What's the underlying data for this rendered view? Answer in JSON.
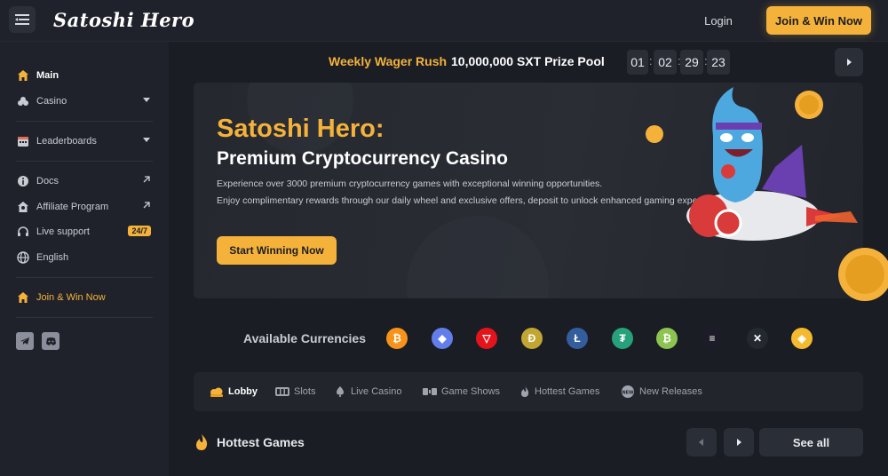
{
  "header": {
    "logo": "Satoshi Hero",
    "login_label": "Login",
    "join_label": "Join & Win Now"
  },
  "sidebar": {
    "items": [
      {
        "label": "Main",
        "icon": "home-icon"
      },
      {
        "label": "Casino",
        "icon": "cards-icon"
      },
      {
        "label": "Leaderboards",
        "icon": "calendar-icon"
      },
      {
        "label": "Docs",
        "icon": "info-icon"
      },
      {
        "label": "Affiliate Program",
        "icon": "affiliate-icon"
      },
      {
        "label": "Live support",
        "icon": "headset-icon",
        "badge": "24/7"
      },
      {
        "label": "English",
        "icon": "globe-icon"
      },
      {
        "label": "Join & Win Now",
        "icon": "home-icon"
      }
    ],
    "social": [
      "telegram-icon",
      "discord-icon"
    ]
  },
  "wager": {
    "title": "Weekly Wager Rush",
    "prize": "10,000,000 SXT Prize Pool",
    "timer": [
      "01",
      "02",
      "29",
      "23"
    ]
  },
  "hero": {
    "title": "Satoshi Hero:",
    "subtitle": "Premium Cryptocurrency Casino",
    "line1": "Experience over 3000 premium cryptocurrency games with exceptional winning opportunities.",
    "line2": "Enjoy complimentary rewards through our daily wheel and exclusive offers, deposit to unlock enhanced gaming experiences!",
    "cta": "Start Winning Now"
  },
  "currencies": {
    "label": "Available Currencies",
    "items": [
      {
        "name": "bitcoin-icon",
        "glyph": "₿",
        "color": "#f7931a"
      },
      {
        "name": "ethereum-icon",
        "glyph": "◆",
        "color": "#627eea"
      },
      {
        "name": "tron-icon",
        "glyph": "▽",
        "color": "#e5141b"
      },
      {
        "name": "dogecoin-icon",
        "glyph": "Ð",
        "color": "#c2a633"
      },
      {
        "name": "litecoin-icon",
        "glyph": "Ł",
        "color": "#345d9d"
      },
      {
        "name": "tether-icon",
        "glyph": "₮",
        "color": "#26a17b"
      },
      {
        "name": "bitcoin-cash-icon",
        "glyph": "₿",
        "color": "#8dc351"
      },
      {
        "name": "solana-icon",
        "glyph": "≡",
        "color": "#1c1c28"
      },
      {
        "name": "xrp-icon",
        "glyph": "✕",
        "color": "#23292f"
      },
      {
        "name": "bnb-icon",
        "glyph": "◈",
        "color": "#f3ba2f"
      }
    ]
  },
  "tabs": [
    {
      "label": "Lobby",
      "icon": "lobby-icon"
    },
    {
      "label": "Slots",
      "icon": "slots-icon"
    },
    {
      "label": "Live Casino",
      "icon": "spade-icon"
    },
    {
      "label": "Game Shows",
      "icon": "game-shows-icon"
    },
    {
      "label": "Hottest Games",
      "icon": "flame-icon"
    },
    {
      "label": "New Releases",
      "icon": "new-icon"
    }
  ],
  "hottest": {
    "title": "Hottest Games",
    "see_all": "See all"
  },
  "colors": {
    "accent": "#f5b23b",
    "background": "#1a1d24",
    "panel": "#1f222a"
  }
}
